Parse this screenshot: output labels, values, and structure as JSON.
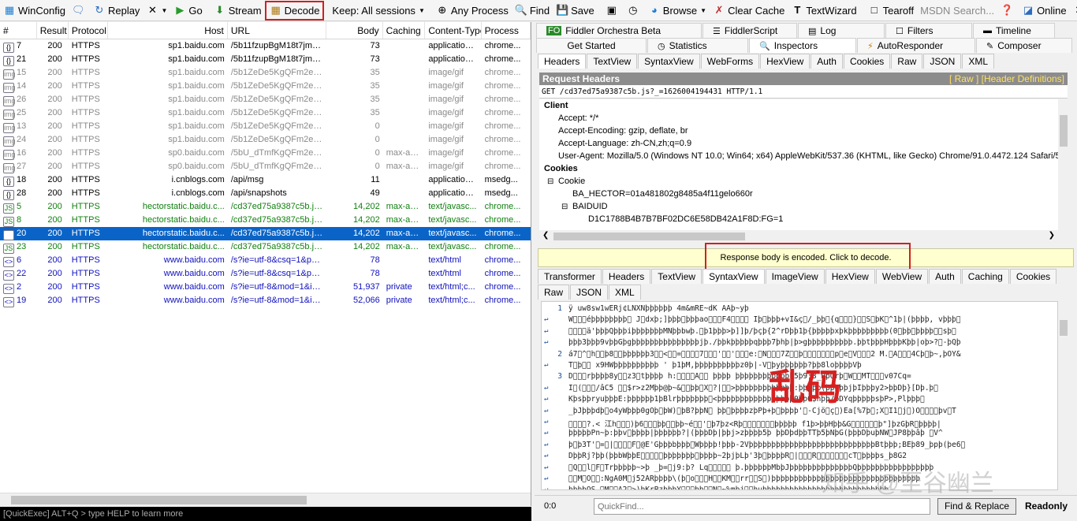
{
  "toolbar": {
    "winconfig": "WinConfig",
    "replay": "Replay",
    "go": "Go",
    "stream": "Stream",
    "decode": "Decode",
    "keep": "Keep: All sessions",
    "any_process": "Any Process",
    "find": "Find",
    "save": "Save",
    "browse": "Browse",
    "clear_cache": "Clear Cache",
    "textwizard": "TextWizard",
    "tearoff": "Tearoff",
    "search_placeholder": "MSDN Search...",
    "online": "Online"
  },
  "sessions": {
    "columns": [
      "#",
      "Result",
      "Protocol",
      "Host",
      "URL",
      "Body",
      "Caching",
      "Content-Type",
      "Process"
    ],
    "rows": [
      {
        "id": "7",
        "icon": "{}",
        "result": "200",
        "protocol": "HTTPS",
        "host": "sp1.baidu.com",
        "url": "/5b11fzupBgM18t7jm9iCK...",
        "body": "73",
        "caching": "",
        "ctype": "application/...",
        "process": "chrome...",
        "style": "black"
      },
      {
        "id": "21",
        "icon": "{}",
        "result": "200",
        "protocol": "HTTPS",
        "host": "sp1.baidu.com",
        "url": "/5b11fzupBgM18t7jm9iCK...",
        "body": "73",
        "caching": "",
        "ctype": "application/...",
        "process": "chrome...",
        "style": "black"
      },
      {
        "id": "15",
        "icon": "img",
        "result": "200",
        "protocol": "HTTPS",
        "host": "sp1.baidu.com",
        "url": "/5b1ZeDe5KgQFm2e88Iu...",
        "body": "35",
        "caching": "",
        "ctype": "image/gif",
        "process": "chrome...",
        "style": "gray"
      },
      {
        "id": "14",
        "icon": "img",
        "result": "200",
        "protocol": "HTTPS",
        "host": "sp1.baidu.com",
        "url": "/5b1ZeDe5KgQFm2e88Iu...",
        "body": "35",
        "caching": "",
        "ctype": "image/gif",
        "process": "chrome...",
        "style": "gray"
      },
      {
        "id": "26",
        "icon": "img",
        "result": "200",
        "protocol": "HTTPS",
        "host": "sp1.baidu.com",
        "url": "/5b1ZeDe5KgQFm2e88Iu...",
        "body": "35",
        "caching": "",
        "ctype": "image/gif",
        "process": "chrome...",
        "style": "gray"
      },
      {
        "id": "25",
        "icon": "img",
        "result": "200",
        "protocol": "HTTPS",
        "host": "sp1.baidu.com",
        "url": "/5b1ZeDe5KgQFm2e88Iu...",
        "body": "35",
        "caching": "",
        "ctype": "image/gif",
        "process": "chrome...",
        "style": "gray"
      },
      {
        "id": "13",
        "icon": "img",
        "result": "200",
        "protocol": "HTTPS",
        "host": "sp1.baidu.com",
        "url": "/5b1ZeDe5KgQFm2e88Iu...",
        "body": "0",
        "caching": "",
        "ctype": "image/gif",
        "process": "chrome...",
        "style": "gray"
      },
      {
        "id": "24",
        "icon": "img",
        "result": "200",
        "protocol": "HTTPS",
        "host": "sp1.baidu.com",
        "url": "/5b1ZeDe5KgQFm2e88Iu...",
        "body": "0",
        "caching": "",
        "ctype": "image/gif",
        "process": "chrome...",
        "style": "gray"
      },
      {
        "id": "16",
        "icon": "img",
        "result": "200",
        "protocol": "HTTPS",
        "host": "sp0.baidu.com",
        "url": "/5bU_dTmfKgQFm2e88Iu...",
        "body": "0",
        "caching": "max-ag...",
        "ctype": "image/gif",
        "process": "chrome...",
        "style": "gray"
      },
      {
        "id": "27",
        "icon": "img",
        "result": "200",
        "protocol": "HTTPS",
        "host": "sp0.baidu.com",
        "url": "/5bU_dTmfKgQFm2e88Iu...",
        "body": "0",
        "caching": "max-ag...",
        "ctype": "image/gif",
        "process": "chrome...",
        "style": "gray"
      },
      {
        "id": "18",
        "icon": "{}",
        "result": "200",
        "protocol": "HTTPS",
        "host": "i.cnblogs.com",
        "url": "/api/msg",
        "body": "11",
        "caching": "",
        "ctype": "application/...",
        "process": "msedg...",
        "style": "black"
      },
      {
        "id": "28",
        "icon": "{}",
        "result": "200",
        "protocol": "HTTPS",
        "host": "i.cnblogs.com",
        "url": "/api/snapshots",
        "body": "49",
        "caching": "",
        "ctype": "application/...",
        "process": "msedg...",
        "style": "black"
      },
      {
        "id": "5",
        "icon": "JS",
        "result": "200",
        "protocol": "HTTPS",
        "host": "hectorstatic.baidu.c...",
        "url": "/cd37ed75a9387c5b.js?_...",
        "body": "14,202",
        "caching": "max-ag...",
        "ctype": "text/javasc...",
        "process": "chrome...",
        "style": "green"
      },
      {
        "id": "8",
        "icon": "JS",
        "result": "200",
        "protocol": "HTTPS",
        "host": "hectorstatic.baidu.c...",
        "url": "/cd37ed75a9387c5b.js?_...",
        "body": "14,202",
        "caching": "max-ag...",
        "ctype": "text/javasc...",
        "process": "chrome...",
        "style": "green"
      },
      {
        "id": "20",
        "icon": "JS",
        "result": "200",
        "protocol": "HTTPS",
        "host": "hectorstatic.baidu.c...",
        "url": "/cd37ed75a9387c5b.js?_...",
        "body": "14,202",
        "caching": "max-ag...",
        "ctype": "text/javasc...",
        "process": "chrome...",
        "style": "sel"
      },
      {
        "id": "23",
        "icon": "JS",
        "result": "200",
        "protocol": "HTTPS",
        "host": "hectorstatic.baidu.c...",
        "url": "/cd37ed75a9387c5b.js?_...",
        "body": "14,202",
        "caching": "max-ag...",
        "ctype": "text/javasc...",
        "process": "chrome...",
        "style": "green"
      },
      {
        "id": "6",
        "icon": "<>",
        "result": "200",
        "protocol": "HTTPS",
        "host": "www.baidu.com",
        "url": "/s?ie=utf-8&csq=1&pstg...",
        "body": "78",
        "caching": "",
        "ctype": "text/html",
        "process": "chrome...",
        "style": "blue"
      },
      {
        "id": "22",
        "icon": "<>",
        "result": "200",
        "protocol": "HTTPS",
        "host": "www.baidu.com",
        "url": "/s?ie=utf-8&csq=1&pstg...",
        "body": "78",
        "caching": "",
        "ctype": "text/html",
        "process": "chrome...",
        "style": "blue"
      },
      {
        "id": "2",
        "icon": "<>",
        "result": "200",
        "protocol": "HTTPS",
        "host": "www.baidu.com",
        "url": "/s?ie=utf-8&mod=1&isbd...",
        "body": "51,937",
        "caching": "private",
        "ctype": "text/html;c...",
        "process": "chrome...",
        "style": "blue"
      },
      {
        "id": "19",
        "icon": "<>",
        "result": "200",
        "protocol": "HTTPS",
        "host": "www.baidu.com",
        "url": "/s?ie=utf-8&mod=1&isbd...",
        "body": "52,066",
        "caching": "private",
        "ctype": "text/html;c...",
        "process": "chrome...",
        "style": "blue"
      }
    ],
    "quickexec": "[QuickExec] ALT+Q > type HELP to learn more"
  },
  "right": {
    "tabs_row1": [
      "Fiddler Orchestra Beta",
      "FiddlerScript",
      "Log",
      "Filters",
      "Timeline"
    ],
    "tabs_row2": [
      "Get Started",
      "Statistics",
      "Inspectors",
      "AutoResponder",
      "Composer"
    ],
    "req_tabs": [
      "Headers",
      "TextView",
      "SyntaxView",
      "WebForms",
      "HexView",
      "Auth",
      "Cookies",
      "Raw",
      "JSON",
      "XML"
    ],
    "request_headers_title": "Request Headers",
    "request_headers_links": "[ Raw ]   [Header Definitions]",
    "get_line": "GET /cd37ed75a9387c5b.js?_=1626004194431 HTTP/1.1",
    "tree": {
      "client": "Client",
      "accept": "Accept: */*",
      "encoding": "Accept-Encoding: gzip, deflate, br",
      "language": "Accept-Language: zh-CN,zh;q=0.9",
      "agent": "User-Agent: Mozilla/5.0 (Windows NT 10.0; Win64; x64) AppleWebKit/537.36 (KHTML, like Gecko) Chrome/91.0.4472.124 Safari/53",
      "cookies": "Cookies",
      "cookie": "Cookie",
      "ba_hector": "BA_HECTOR=01a481802g8485a4f11gelo660r",
      "baiduid": "BAIDUID",
      "baiduid_val": "D1C1788B4B7B7BF02DC6E58DB42A1F8D:FG=1"
    },
    "banner": "Response body is encoded. Click to decode.",
    "resp_tabs": [
      "Transformer",
      "Headers",
      "TextView",
      "SyntaxView",
      "ImageView",
      "HexView",
      "WebView",
      "Auth",
      "Caching",
      "Cookies"
    ],
    "resp_tabs2": [
      "Raw",
      "JSON",
      "XML"
    ],
    "garbled_lines": [
      "ÿ\u0001\u0000\u0000\u0000\u0000\u0000\u0000\u0000 uw\u00118\u0000\u0000\u0000\u0000sw\u00101wER\u0000\u0000\u0000\u0000\u0000\u0000j\u0010\u0000¢L\u0000N\u0000XNþþþþþþ 4\u0000\u0000m\u0000&m\u0000\u0000\u0000\u0000R\u0000E\u0000\u0000\u0000~\u0000\u0000\u0000\u0000dK A\u0000\u0000A\u0000\u0000þ~yþ\u0000",
      "W\u0000\u0000\u0000éþþþþþþþþ\u0000 J\u0000dxþ;]þþþ\u0000þþþao\u0000\u0000\u0000F4\u0000\u0000\u0000\u0000  Iþ\u0000þþþ+vI&ç\u0000/_þþ\u0000{q\u0000\u0000\u0000}\u0000\u0000S\u0000þK\u0000^1þ|(þþþþ,  vþþþ\u0000",
      "\u0000\u0000\u0000\u0000ä'þþþQþþþiþþþþþþþMNþþbwþ.\u0000þ1þþþ>þ]]þ/þçþ{2^rDþþ1þ{þþþþþxþkþþþþþþþþþ(0\u0000þþ\u0000þþþþ\u0000\u0000sþ\u0000",
      "þþþ3þþþ9vþþGþgþþþþþþþþþþþþþþþjþ./þþkþþþþþqþþþ7þhþ|þ>gþþþþþþþþþþ.þþtþþþHþþþKþþ|oþ>?\u0000-þQþ",
      "á7\u0000^\u0000h\u0000\u0000þ8\u0000\u0000þþþþþþ3\u0000\u0000<\u0000\u0000=\u0000\u0000\u0000\u00007\u0000\u0000\u0000'\u0000\u0000'\u0000\u0000\u0000e:\u0000N\u0000\u0000\u00007Z\u0000\u0000þ\u0000\u0000\u0000\u0000\u0000\u0000\u0000p\u0000e\u0000V\u0000\u0000\u00002 M.\u0000A\u0000\u0000\u00004Cþ\u0000þ~,þOY&",
      "    T\u0000þ\u0000\u0000      x9HWþþþþþþþþþþ ' þ1þM,þþþþþþþþþþz0þ|-V\u0000þyþþþþþþ?þþ8loþþþþVþ",
      "D\u0000\u0000\u0000rþþþþ8y\u0000\u0000z3\u0000tþþþþ  h:\u0000\u0000\u0000\u0000A\u0000\u0000  þþþþ þþþþþþþþþþþþk5þ9;8_PþQrþ\u0000W\u0000\u0000MT\u0000\u0000\u0000v07Cq=",
      "I\u0000(\u0000\u0000\u0000/âC5 \u0000\u0000$r>z2Mþþ@þ~&\u0000\u0000þþ\u0000X\u0000?|\u0000\u0000>þþþþþþþþþþþþþ:þþþþþ(þþþþþjþIþþþy2>þþDþ}[Dþ.þ\u0000",
      "KþsþþryuþþþE:þþþþþþ1þBlrþþþþþþþ\u0000<þþþþþþþþþþþþþþþþþ0þþO$nþþ/þDYqþþþþþsþP>,Plþþþ\u0000",
      "_þJþþþdþ\u0000o4yWþþþ0gOþ\u0000þW)\u0000þB?þþN\u0000 þþ\u0000þþþþzþPþ+þ\u0000þþþþ'\u0000-Cjö\u0000ç\u0000)Ea[%7þ\u0000;X\u0000I1\u0000j\u0000)O\u0000\u0000\u0000\u0000þv\u0000T",
      "\u0000\u0000\u0000\u0000?.< 江h\u0000\u0000\u0000)þ6\u0000\u0000\u0000þþ\u0000\u0000þþ~é\u0000\u0000'\u0000þ7þz<Rþ\u0000\u0000\u0000\u0000\u0000\u0000\u0000þþþþþ f1þ>þþHþþ&G\u0000\u0000\u0000\u0000\u0000\u0000þ\"]þzGþR\u0000þþþþ|",
      "þþþþþPn~þ:þþv\u0000þþþþ|þþþþþþ?|(þþþDþ|þþj>zþþþþ5þ  þþDþdþþTTþ5þNþG(þþþDþuþNW\u0000JP8þþâþ      \u0000V^",
      "þ\u0000þ3T'\u0000=\u0000|\u0000\u0000\u0000\u0000F\u0000@E'Gþþþbþþþ\u0000Wþþþþ!þþþ-2VþþþþþþþþþþþþþþþþþþþþþþþþþþþþBtþþþ;BEþ89_þpþ(þe6\u0000",
      "DþþRj?þþ(þþbWþþE\u0000\u0000\u0000\u0000\u0000þþþþþþþ\u0000þþþþ~2þjþLþ'3þ\u0000þþþþR\u0000|\u0000\u0000\u0000R\u0000\u0000\u0000\u0000\u0000\u0000\u0000cT\u0000þþþþs_þ8G2",
      "\u0000Q\u0000\u0000l\u0000F\u0000Trþþþþþ~>þ  _þ=\u0000j9:þ? Lq\u0000\u0000\u0000\u0000\u0000    þ.þþþþþþMbþJþþþþþþþþþþþþþþQþþþþþþþþþþþþþþþþþ",
      "\u0000\u0000M\u0000O\u0000\u0000:NgA0M\u0000j52ARþþþþ\\(þ\u0000o\u0000\u0000\u0000H\u0000\u0000KM\u0000\u0000rr\u0000\u0000S\u0000)þþþþþþþþþþþþþþþþþþþþþþþþþþþþþþþþþ",
      "þþþþQS \u0000M\u0000\u0000A2\u0000>)þKrPzþþþY\u0000\u0000\u0000þb\u0000\u0000N\u0000~%mþj\u0000\u0000huþþþþþþþþþþþþþþþþþþþþþþþþþþþþ"
    ],
    "annotation": "乱码",
    "watermark": "知乎 @至谷幽兰",
    "status": {
      "position": "0:0",
      "quickfind_placeholder": "QuickFind...",
      "find_replace": "Find & Replace",
      "ready": "Readonly"
    }
  }
}
